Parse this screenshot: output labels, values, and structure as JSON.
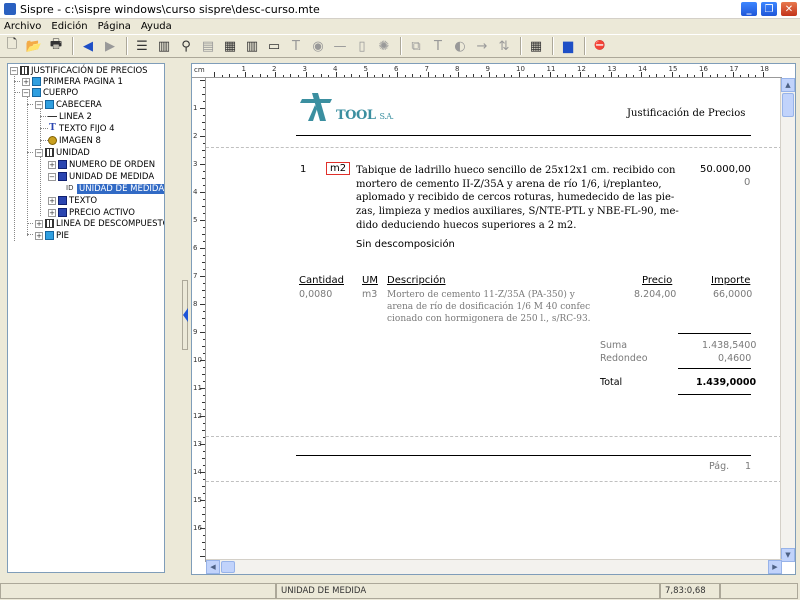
{
  "window": {
    "title": "Sispre - c:\\sispre windows\\curso sispre\\desc-curso.mte",
    "minimize": "_",
    "maximize": "❐",
    "close": "✕"
  },
  "menu": [
    "Archivo",
    "Edición",
    "Página",
    "Ayuda"
  ],
  "tree": {
    "root": "JUSTIFICACIÓN DE PRECIOS",
    "primera_pagina": "PRIMERA PAGINA 1",
    "cuerpo": "CUERPO",
    "cabecera": "CABECERA",
    "linea": "LINEA 2",
    "texto_fijo": "TEXTO FIJO 4",
    "imagen": "IMAGEN 8",
    "unidad": "UNIDAD",
    "numero_orden": "NUMERO DE ORDEN",
    "unidad_medida": "UNIDAD DE MEDIDA",
    "unidad_medida_sel": "UNIDAD DE MEDIDA",
    "id_tag": "ID",
    "texto": "TEXTO",
    "precio_activo": "PRECIO ACTIVO",
    "linea_descompuesto": "LINEA DE DESCOMPUESTO",
    "pie": "PIE"
  },
  "ruler": {
    "unit": "cm",
    "top_numbers": [
      "1",
      "2",
      "3",
      "4",
      "5",
      "6",
      "7",
      "8",
      "9",
      "10",
      "11",
      "12",
      "13",
      "14",
      "15",
      "16",
      "17",
      "18"
    ],
    "left_numbers": [
      "1",
      "2",
      "3",
      "4",
      "5",
      "6",
      "7",
      "8",
      "9",
      "10",
      "11",
      "12",
      "13",
      "14",
      "15",
      "16"
    ]
  },
  "doc": {
    "logo_text": "TOOL",
    "logo_sa": "S.A.",
    "header_title": "Justificación de Precios",
    "item_number": "1",
    "unit": "m2",
    "description_lines": [
      "Tabique de ladrillo hueco sencillo de 25x12x1 cm. recibido con",
      "mortero de cemento II-Z/35A y arena de río 1/6, i/replanteo,",
      "aplomado y recibido de cercos roturas, humedecido de las pie-",
      "zas, limpieza y medios auxiliares, S/NTE-PTL y NBE-FL-90, me-",
      "dido deduciendo huecos superiores a 2 m2."
    ],
    "quantity": "50.000,00",
    "quantity_sub": "0",
    "no_decomp": "Sin descomposición",
    "table_headers": {
      "cantidad": "Cantidad",
      "um": "UM",
      "descripcion": "Descripción",
      "precio": "Precio",
      "importe": "Importe"
    },
    "row": {
      "cantidad": "0,0080",
      "um": "m3",
      "descripcion_lines": [
        "Mortero de cemento 11-Z/35A (PA-350) y",
        "arena de río de dosificación 1/6 M 40 confec",
        "cionado con hormigonera de 250 l., s/RC-93."
      ],
      "precio": "8.204,00",
      "importe": "66,0000"
    },
    "suma_label": "Suma",
    "suma_value": "1.438,5400",
    "redondeo_label": "Redondeo",
    "redondeo_value": "0,4600",
    "total_label": "Total",
    "total_value": "1.439,0000",
    "pag_label": "Pág.",
    "pag_value": "1"
  },
  "statusbar": {
    "left": "",
    "center": "UNIDAD DE MEDIDA",
    "right": "7,83:0,68"
  }
}
